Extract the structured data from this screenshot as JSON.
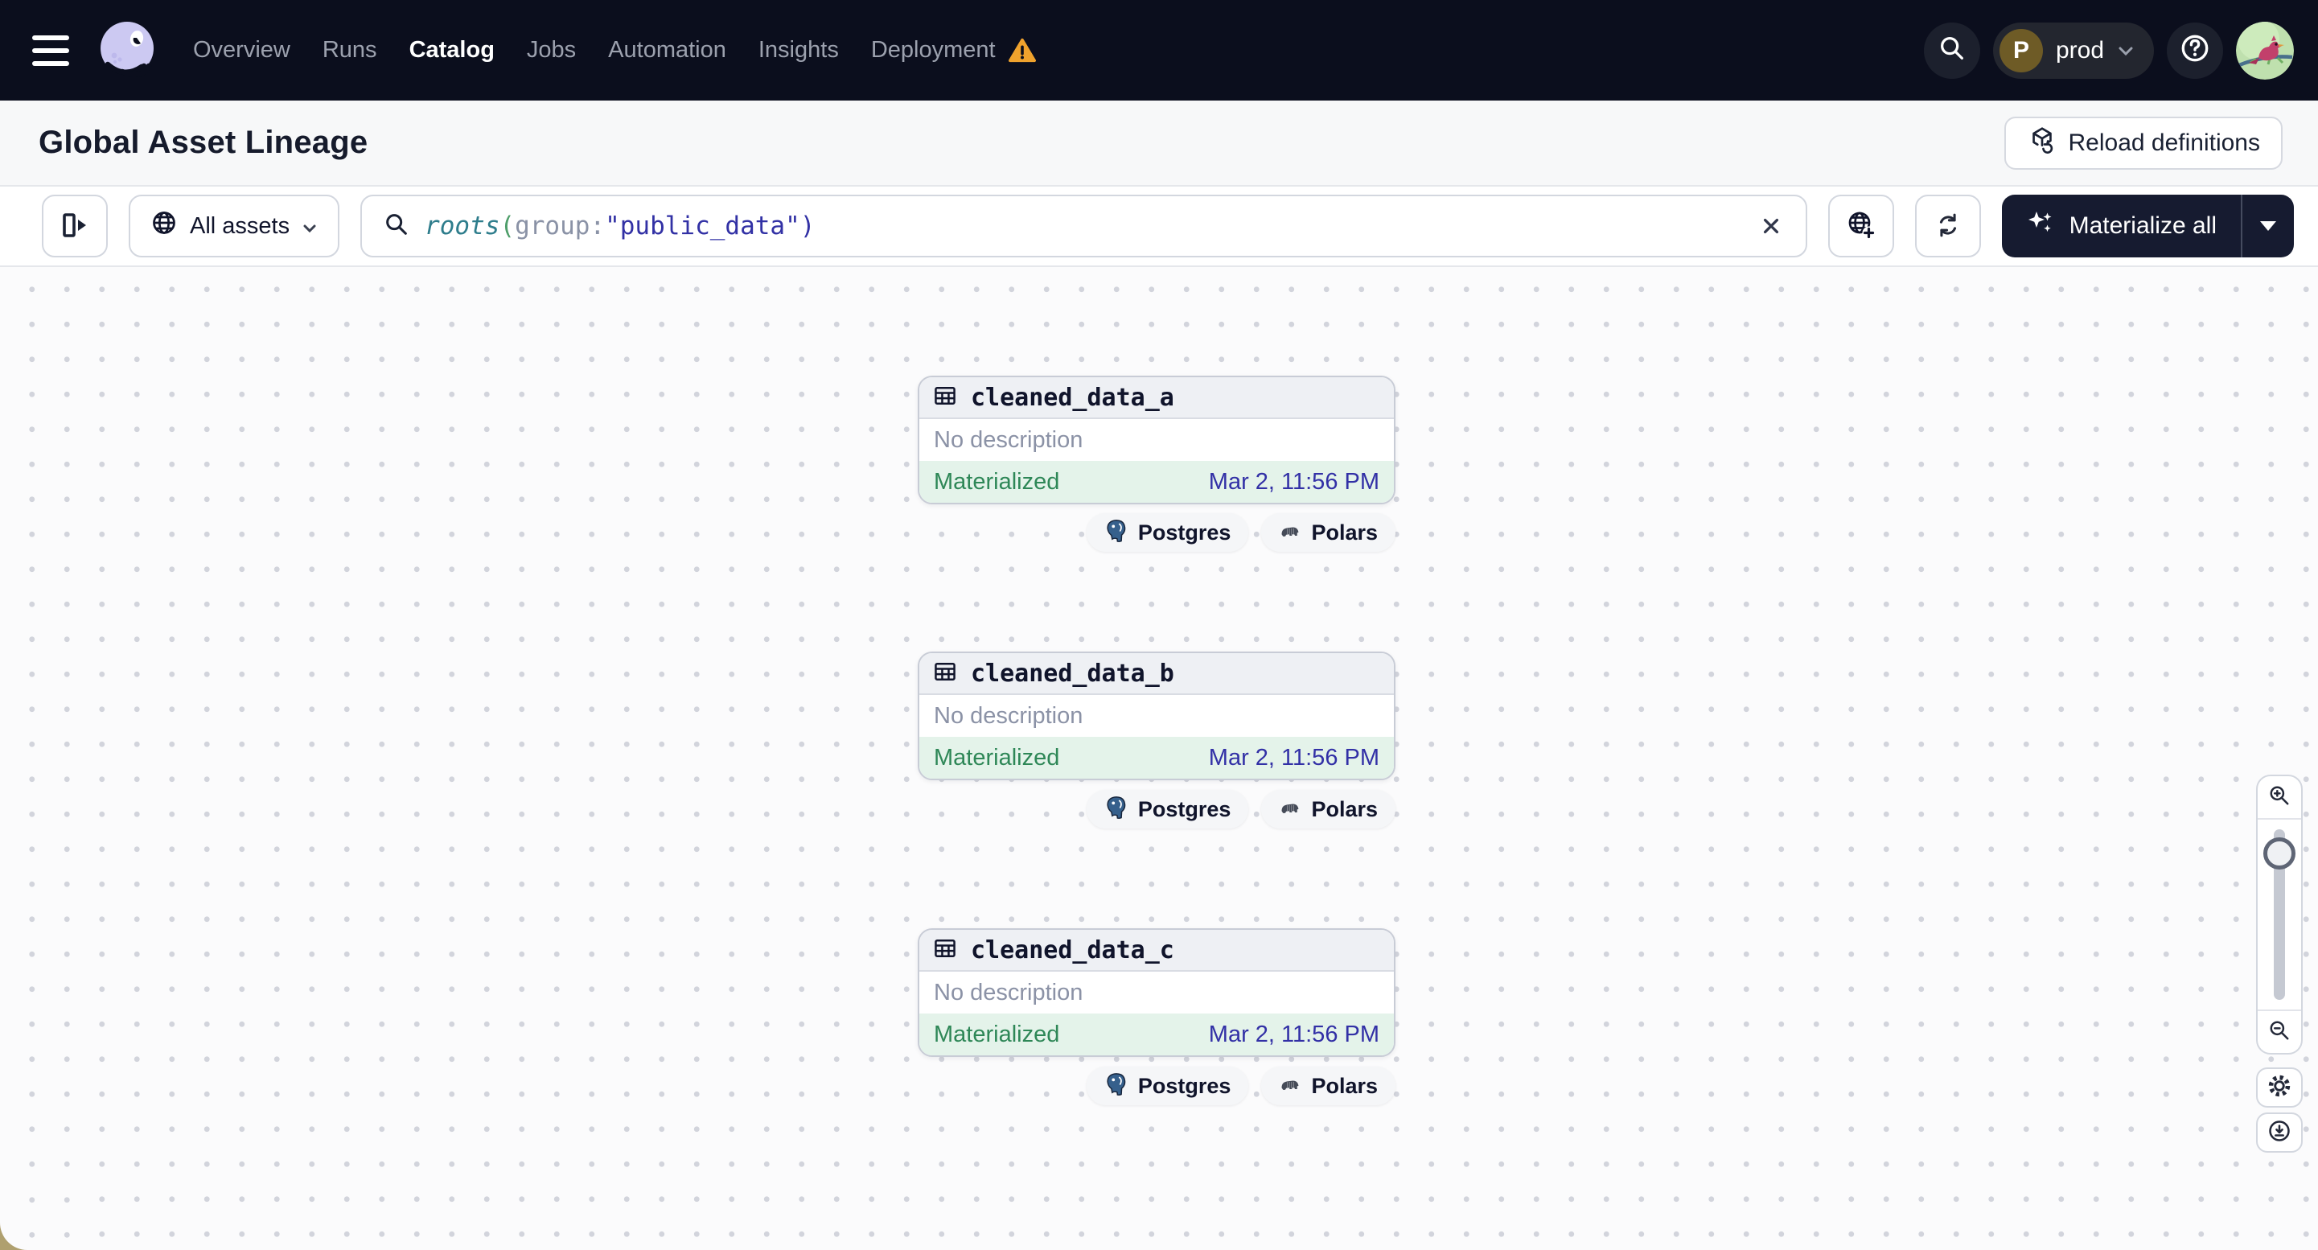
{
  "nav": {
    "links": [
      {
        "label": "Overview",
        "active": false
      },
      {
        "label": "Runs",
        "active": false
      },
      {
        "label": "Catalog",
        "active": true
      },
      {
        "label": "Jobs",
        "active": false
      },
      {
        "label": "Automation",
        "active": false
      },
      {
        "label": "Insights",
        "active": false
      },
      {
        "label": "Deployment",
        "active": false
      }
    ],
    "deployment_has_warning": true,
    "environment": {
      "initial": "P",
      "name": "prod"
    },
    "help_symbol": "?"
  },
  "header": {
    "title": "Global Asset Lineage",
    "reload_button_label": "Reload definitions"
  },
  "toolbar": {
    "scope_button_label": "All assets",
    "search_query": {
      "fn": "roots",
      "open_paren": "(",
      "arg_key": "group",
      "colon": ":",
      "arg_value": "\"public_data\"",
      "close_paren": ")"
    },
    "materialize_button_label": "Materialize all"
  },
  "canvas": {
    "assets": [
      {
        "name": "cleaned_data_a",
        "description": "No description",
        "status": "Materialized",
        "last_materialized": "Mar 2, 11:56 PM",
        "tags": [
          "Postgres",
          "Polars"
        ]
      },
      {
        "name": "cleaned_data_b",
        "description": "No description",
        "status": "Materialized",
        "last_materialized": "Mar 2, 11:56 PM",
        "tags": [
          "Postgres",
          "Polars"
        ]
      },
      {
        "name": "cleaned_data_c",
        "description": "No description",
        "status": "Materialized",
        "last_materialized": "Mar 2, 11:56 PM",
        "tags": [
          "Postgres",
          "Polars"
        ]
      }
    ]
  },
  "colors": {
    "nav_bg": "#0B0E1D",
    "warning_orange": "#EFA22D",
    "materialized_green": "#2E8757",
    "materialized_row_bg": "#E4F3EA",
    "timestamp_blue": "#3230A6",
    "query_fn_teal": "#2E7D8C",
    "query_value_navy": "#3231A5",
    "dark_button_bg": "#161B30"
  }
}
